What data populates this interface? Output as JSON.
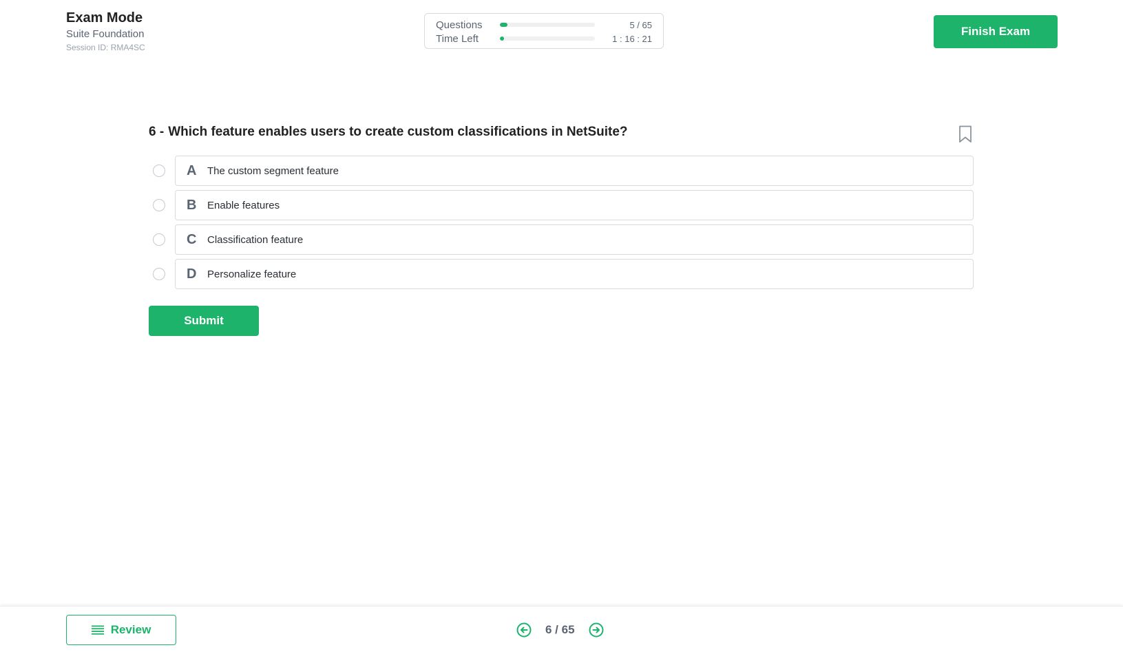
{
  "header": {
    "mode_title": "Exam Mode",
    "exam_name": "Suite Foundation",
    "session_id": "Session ID: RMA4SC",
    "finish_label": "Finish Exam"
  },
  "progress": {
    "questions_label": "Questions",
    "questions_value": "5 / 65",
    "questions_fraction": 0.077,
    "time_label": "Time Left",
    "time_value": "1 : 16 : 21",
    "time_fraction": 0.04
  },
  "question": {
    "number": "6 -",
    "text": "Which feature enables users to create custom classifications in NetSuite?",
    "options": [
      {
        "letter": "A",
        "text": "The custom segment feature"
      },
      {
        "letter": "B",
        "text": "Enable features"
      },
      {
        "letter": "C",
        "text": "Classification feature"
      },
      {
        "letter": "D",
        "text": "Personalize feature"
      }
    ],
    "submit_label": "Submit"
  },
  "footer": {
    "review_label": "Review",
    "pager_text": "6 / 65"
  },
  "colors": {
    "accent": "#1db36b",
    "muted_text": "#5a6472",
    "border": "#d7dbe0"
  },
  "icons": {
    "bookmark": "bookmark-icon",
    "review": "list-icon",
    "prev": "arrow-left-circle-icon",
    "next": "arrow-right-circle-icon"
  }
}
